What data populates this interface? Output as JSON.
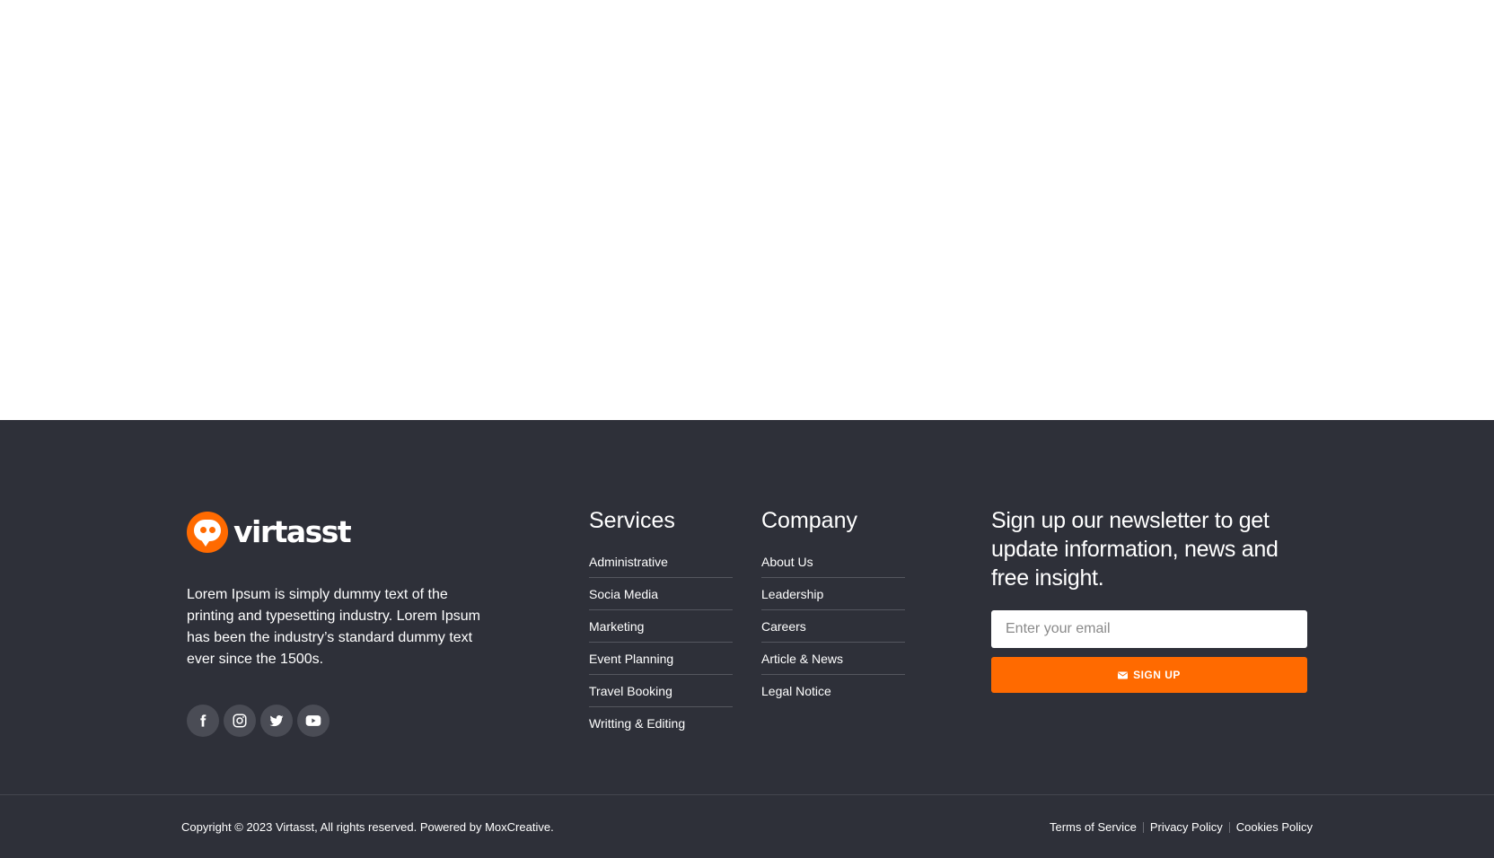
{
  "brand": {
    "name": "virtasst",
    "description": "Lorem Ipsum is simply dummy text of the printing and typesetting industry. Lorem Ipsum has been the industry’s standard dummy text ever since the 1500s.",
    "accent_color": "#ff6a00"
  },
  "social": [
    {
      "icon": "facebook-icon"
    },
    {
      "icon": "instagram-icon"
    },
    {
      "icon": "twitter-icon"
    },
    {
      "icon": "youtube-icon"
    }
  ],
  "services": {
    "title": "Services",
    "items": [
      "Administrative",
      "Socia Media",
      "Marketing",
      "Event Planning",
      "Travel Booking",
      "Writting & Editing"
    ]
  },
  "company": {
    "title": "Company",
    "items": [
      "About Us",
      "Leadership",
      "Careers",
      "Article & News",
      "Legal Notice"
    ]
  },
  "newsletter": {
    "title": "Sign up our newsletter to get update information, news and free insight.",
    "email_placeholder": "Enter your email",
    "email_value": "",
    "signup_label": "SIGN UP"
  },
  "bottom": {
    "copyright": "Copyright © 2023 Virtasst, All rights reserved. Powered by MoxCreative.",
    "links": [
      "Terms of Service",
      "Privacy Policy",
      "Cookies Policy"
    ]
  },
  "colors": {
    "footer_bg": "#2e3039",
    "button_bg": "#ff6a00"
  }
}
